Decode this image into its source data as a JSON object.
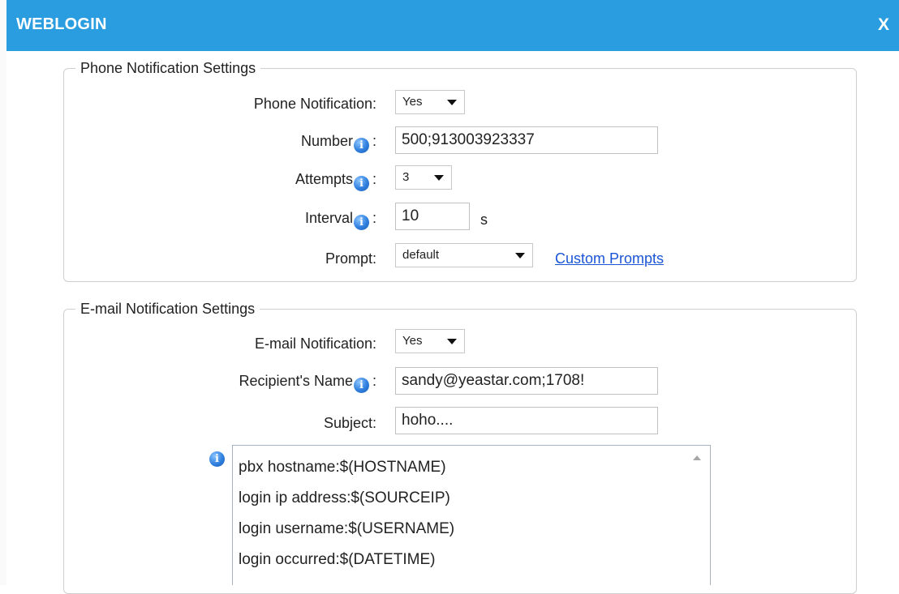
{
  "dialog": {
    "title": "WEBLOGIN",
    "close_label": "X"
  },
  "phone_settings": {
    "legend": "Phone Notification Settings",
    "notification_label": "Phone Notification:",
    "notification_value": "Yes",
    "number_label": "Number",
    "number_value": "500;913003923337",
    "attempts_label": "Attempts",
    "attempts_value": "3",
    "interval_label": "Interval",
    "interval_value": "10",
    "interval_unit": "s",
    "prompt_label": "Prompt:",
    "prompt_value": "default",
    "custom_prompts_link": "Custom Prompts"
  },
  "email_settings": {
    "legend": "E-mail Notification Settings",
    "notification_label": "E-mail Notification:",
    "notification_value": "Yes",
    "recipient_label": "Recipient's Name",
    "recipient_value": "sandy@yeastar.com;1708!",
    "subject_label": "Subject:",
    "subject_value": "hoho....",
    "body_lines": [
      "pbx hostname:$(HOSTNAME)",
      "login ip address:$(SOURCEIP)",
      "login username:$(USERNAME)",
      "login occurred:$(DATETIME)"
    ]
  },
  "colors": {
    "titlebar": "#2a9de0",
    "link": "#1a55d6",
    "info_icon": "#2f7fde"
  },
  "icons": {
    "info": "info-icon",
    "dropdown": "chevron-down-icon",
    "close": "close-icon"
  },
  "info_glyph": "i",
  "colon": ":"
}
